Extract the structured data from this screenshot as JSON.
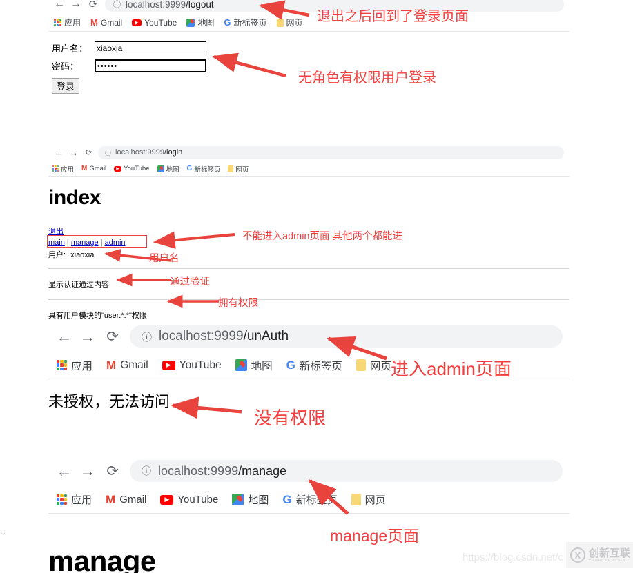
{
  "bookmarks": [
    {
      "icon": "apps-grid-icon",
      "label": "应用"
    },
    {
      "icon": "gmail-icon",
      "label": "Gmail"
    },
    {
      "icon": "youtube-icon",
      "label": "YouTube"
    },
    {
      "icon": "maps-icon",
      "label": "地图"
    },
    {
      "icon": "google-icon",
      "label": "新标签页"
    },
    {
      "icon": "folder-icon",
      "label": "网页"
    }
  ],
  "nav": {
    "back": "←",
    "forward": "→",
    "reload": "⟳",
    "info": "ⓘ"
  },
  "shot1": {
    "url_host": "localhost:9999",
    "url_path": "/logout",
    "form": {
      "username_label": "用户名：",
      "username_value": "xiaoxia",
      "password_label": "密码：",
      "password_value": "••••••",
      "submit_label": "登录"
    },
    "annotations": [
      {
        "name": "annotation-logout-redirect",
        "text": "退出之后回到了登录页面"
      },
      {
        "name": "annotation-no-role-user-login",
        "text": "无角色有权限用户登录"
      }
    ]
  },
  "shot2": {
    "url_host": "localhost:9999",
    "url_path": "/login",
    "heading": "index",
    "logout_link": "退出",
    "nav_links": [
      "main",
      "manage",
      "admin"
    ],
    "nav_sep": "|",
    "user_line_label": "用户:",
    "user_line_value": "xiaoxia",
    "auth_text": "显示认证通过内容",
    "perm_text": "具有用户模块的\"user:*:*\"权限",
    "annotations": [
      {
        "name": "annotation-admin-denied",
        "text": "不能进入admin页面 其他两个都能进"
      },
      {
        "name": "annotation-username",
        "text": "用户名"
      },
      {
        "name": "annotation-auth-passed",
        "text": "通过验证"
      },
      {
        "name": "annotation-has-permission",
        "text": "拥有权限"
      }
    ]
  },
  "shot3": {
    "url_host": "localhost:9999",
    "url_path": "/unAuth",
    "body_text": "未授权，无法访问",
    "annotations": [
      {
        "name": "annotation-enter-admin-page",
        "text": "进入admin页面"
      },
      {
        "name": "annotation-no-permission",
        "text": "没有权限"
      }
    ]
  },
  "shot4": {
    "url_host": "localhost:9999",
    "url_path": "/manage",
    "heading": "manage",
    "annotations": [
      {
        "name": "annotation-manage-page",
        "text": "manage页面"
      }
    ]
  },
  "watermark": {
    "url": "https://blog.csdn.net/c",
    "mark": "X",
    "brand": "创新互联",
    "brand_sub": "CHUANG XIN HU LIAN"
  },
  "colors": {
    "annotation_red": "#f24040",
    "link_blue": "#0000cc",
    "omnibox_bg": "#f1f3f4"
  }
}
